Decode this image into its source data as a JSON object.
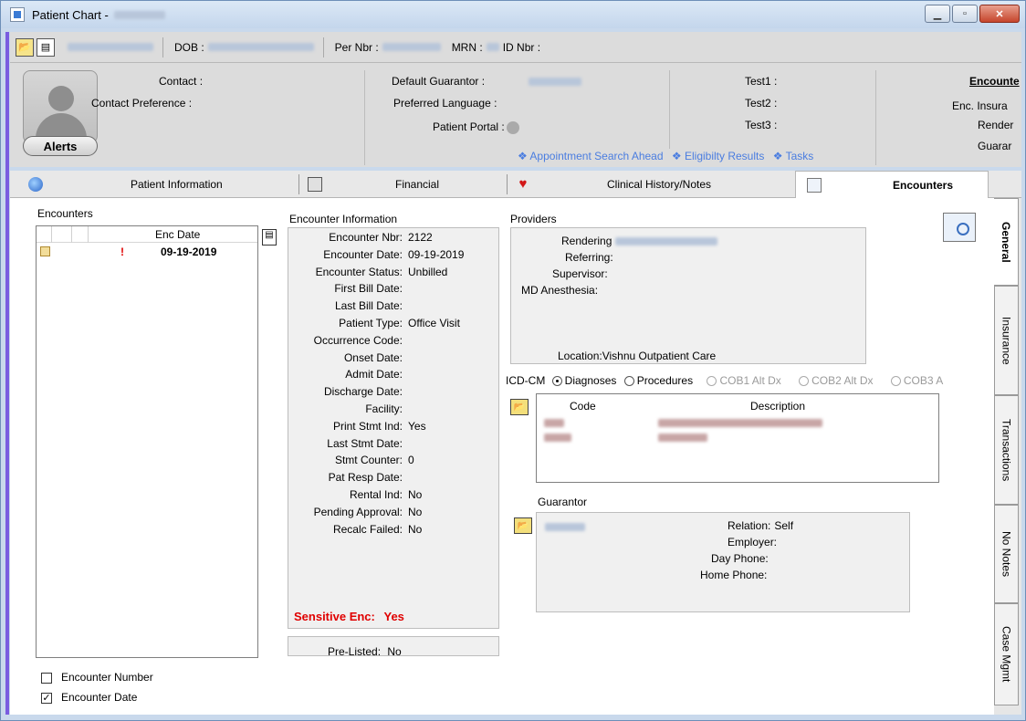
{
  "window": {
    "title": "Patient Chart -",
    "controls": [
      "minimize",
      "maximize",
      "close"
    ]
  },
  "id_bar": {
    "dob_label": "DOB :",
    "per_nbr_label": "Per Nbr :",
    "mrn_label": "MRN :",
    "id_nbr_label": "ID Nbr :"
  },
  "demographics": {
    "alerts_label": "Alerts",
    "contact_label": "Contact :",
    "contact_pref_label": "Contact Preference :",
    "default_guarantor_label": "Default Guarantor :",
    "preferred_language_label": "Preferred Language :",
    "patient_portal_label": "Patient Portal :",
    "test1_label": "Test1 :",
    "test2_label": "Test2 :",
    "test3_label": "Test3 :",
    "encounter_heading": "Encounte",
    "enc_insurance_label": "Enc. Insura",
    "rendering_label": "Render",
    "guarantor_label": "Guarar",
    "links": [
      "❖ Appointment Search Ahead",
      "❖ Eligibilty Results",
      "❖ Tasks"
    ]
  },
  "tabs": [
    {
      "label": "Patient Information",
      "icon": "globe-icon",
      "active": false
    },
    {
      "label": "Financial",
      "icon": "calculator-icon",
      "active": false
    },
    {
      "label": "Clinical History/Notes",
      "icon": "heart-icon",
      "active": false
    },
    {
      "label": "Encounters",
      "icon": "encounter-icon",
      "active": true
    }
  ],
  "encounters_list": {
    "title": "Encounters",
    "column_header": "Enc Date",
    "rows": [
      {
        "flag": "!",
        "date": "09-19-2019"
      }
    ],
    "options": [
      {
        "label": "Encounter Number",
        "checked": false
      },
      {
        "label": "Encounter Date",
        "checked": true
      }
    ]
  },
  "encounter_info": {
    "title": "Encounter Information",
    "fields": [
      {
        "label": "Encounter Nbr:",
        "value": "2122"
      },
      {
        "label": "Encounter Date:",
        "value": "09-19-2019"
      },
      {
        "label": "Encounter Status:",
        "value": "Unbilled"
      },
      {
        "label": "First Bill Date:",
        "value": ""
      },
      {
        "label": "Last Bill Date:",
        "value": ""
      },
      {
        "label": "Patient Type:",
        "value": "Office Visit"
      },
      {
        "label": "Occurrence Code:",
        "value": ""
      },
      {
        "label": "Onset Date:",
        "value": ""
      },
      {
        "label": "Admit Date:",
        "value": ""
      },
      {
        "label": "Discharge Date:",
        "value": ""
      },
      {
        "label": "Facility:",
        "value": ""
      },
      {
        "label": "Print Stmt Ind:",
        "value": "Yes"
      },
      {
        "label": "Last Stmt Date:",
        "value": ""
      },
      {
        "label": "Stmt Counter:",
        "value": "0"
      },
      {
        "label": "Pat Resp Date:",
        "value": ""
      },
      {
        "label": "Rental Ind:",
        "value": "No"
      },
      {
        "label": "Pending Approval:",
        "value": "No"
      },
      {
        "label": "Recalc Failed:",
        "value": "No"
      }
    ],
    "sensitive_label": "Sensitive Enc:",
    "sensitive_value": "Yes",
    "prelisted_label": "Pre-Listed:",
    "prelisted_value": "No"
  },
  "providers": {
    "title": "Providers",
    "rendering_label": "Rendering",
    "referring_label": "Referring:",
    "supervisor_label": "Supervisor:",
    "md_anesthesia_label": "MD Anesthesia:",
    "location_label": "Location:",
    "location_value": "Vishnu Outpatient Care"
  },
  "icd": {
    "label": "ICD-CM",
    "options": [
      {
        "label": "Diagnoses",
        "selected": true,
        "enabled": true
      },
      {
        "label": "Procedures",
        "selected": false,
        "enabled": true
      },
      {
        "label": "COB1 Alt Dx",
        "selected": false,
        "enabled": false
      },
      {
        "label": "COB2 Alt Dx",
        "selected": false,
        "enabled": false
      },
      {
        "label": "COB3 A",
        "selected": false,
        "enabled": false
      }
    ],
    "code_header": "Code",
    "description_header": "Description"
  },
  "guarantor": {
    "title": "Guarantor",
    "relation_label": "Relation:",
    "relation_value": "Self",
    "employer_label": "Employer:",
    "day_phone_label": "Day Phone:",
    "home_phone_label": "Home Phone:"
  },
  "side_tabs": [
    {
      "label": "General",
      "active": true
    },
    {
      "label": "Insurance",
      "active": false
    },
    {
      "label": "Transactions",
      "active": false
    },
    {
      "label": "No Notes",
      "active": false
    },
    {
      "label": "Case Mgmt",
      "active": false
    }
  ],
  "colors": {
    "accent_purple": "#7a5ce0",
    "link_blue": "#4a7de0",
    "alert_red": "#e00000"
  }
}
